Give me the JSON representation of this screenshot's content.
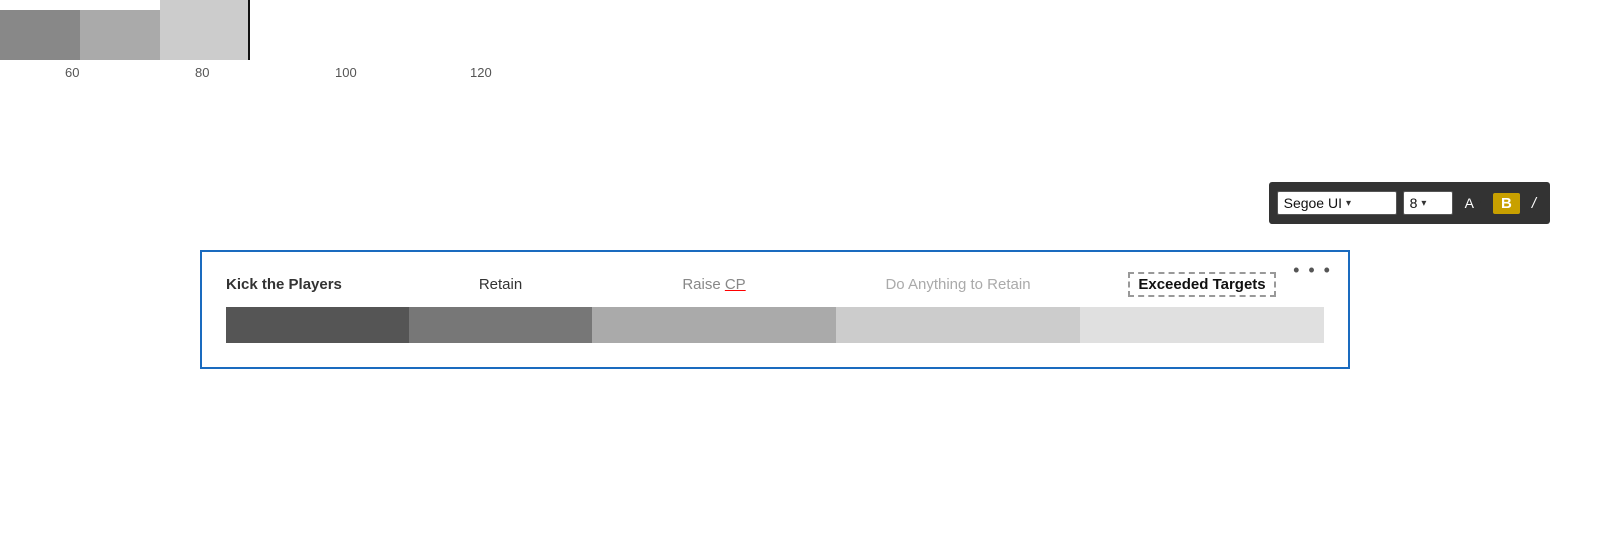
{
  "chart": {
    "axis_labels": [
      {
        "value": "60",
        "position": 0
      },
      {
        "value": "80",
        "position": 130
      },
      {
        "value": "100",
        "position": 270
      },
      {
        "value": "120",
        "position": 420
      }
    ]
  },
  "toolbar": {
    "font_name": "Segoe UI",
    "font_size": "8",
    "font_size_chevron": "▾",
    "font_chevron": "▾",
    "a_label": "A",
    "a_chevron": "▾",
    "bold_label": "B",
    "italic_label": "/"
  },
  "legend": {
    "more_dots": "• • •",
    "labels": [
      {
        "id": "kick",
        "text": "Kick the Players",
        "style": "first"
      },
      {
        "id": "retain",
        "text": "Retain",
        "style": "normal"
      },
      {
        "id": "raise-cp",
        "text": "Raise CP",
        "style": "raise-cp",
        "underline": "CP"
      },
      {
        "id": "do-anything",
        "text": "Do Anything to Retain",
        "style": "do-anything"
      },
      {
        "id": "exceeded",
        "text": "Exceeded Targets",
        "style": "exceeded"
      }
    ],
    "bar_segments": [
      {
        "id": "seg1",
        "label": "darkest"
      },
      {
        "id": "seg2",
        "label": "dark"
      },
      {
        "id": "seg3",
        "label": "medium"
      },
      {
        "id": "seg4",
        "label": "light"
      },
      {
        "id": "seg5",
        "label": "lightest"
      }
    ]
  }
}
